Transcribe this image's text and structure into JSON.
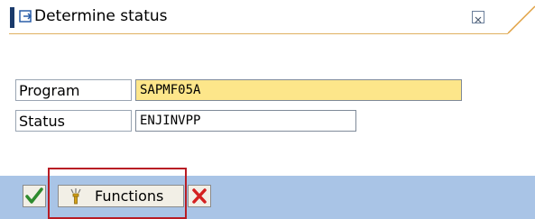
{
  "dialog": {
    "title": "Determine status",
    "close_icon": "close-icon",
    "title_icon": "dialog-icon"
  },
  "form": {
    "program_label": "Program",
    "program_value": "SAPMF05A",
    "status_label": "Status",
    "status_value": "ENJINVPP"
  },
  "footer": {
    "functions_label": "Functions",
    "ok_icon": "checkmark-icon",
    "cancel_icon": "cancel-icon",
    "functions_icon": "functions-icon"
  },
  "colors": {
    "title_accent": "#1a3a6b",
    "required_field": "#fde68a",
    "footer_bg": "#a9c4e6",
    "highlight": "#b81c24"
  }
}
